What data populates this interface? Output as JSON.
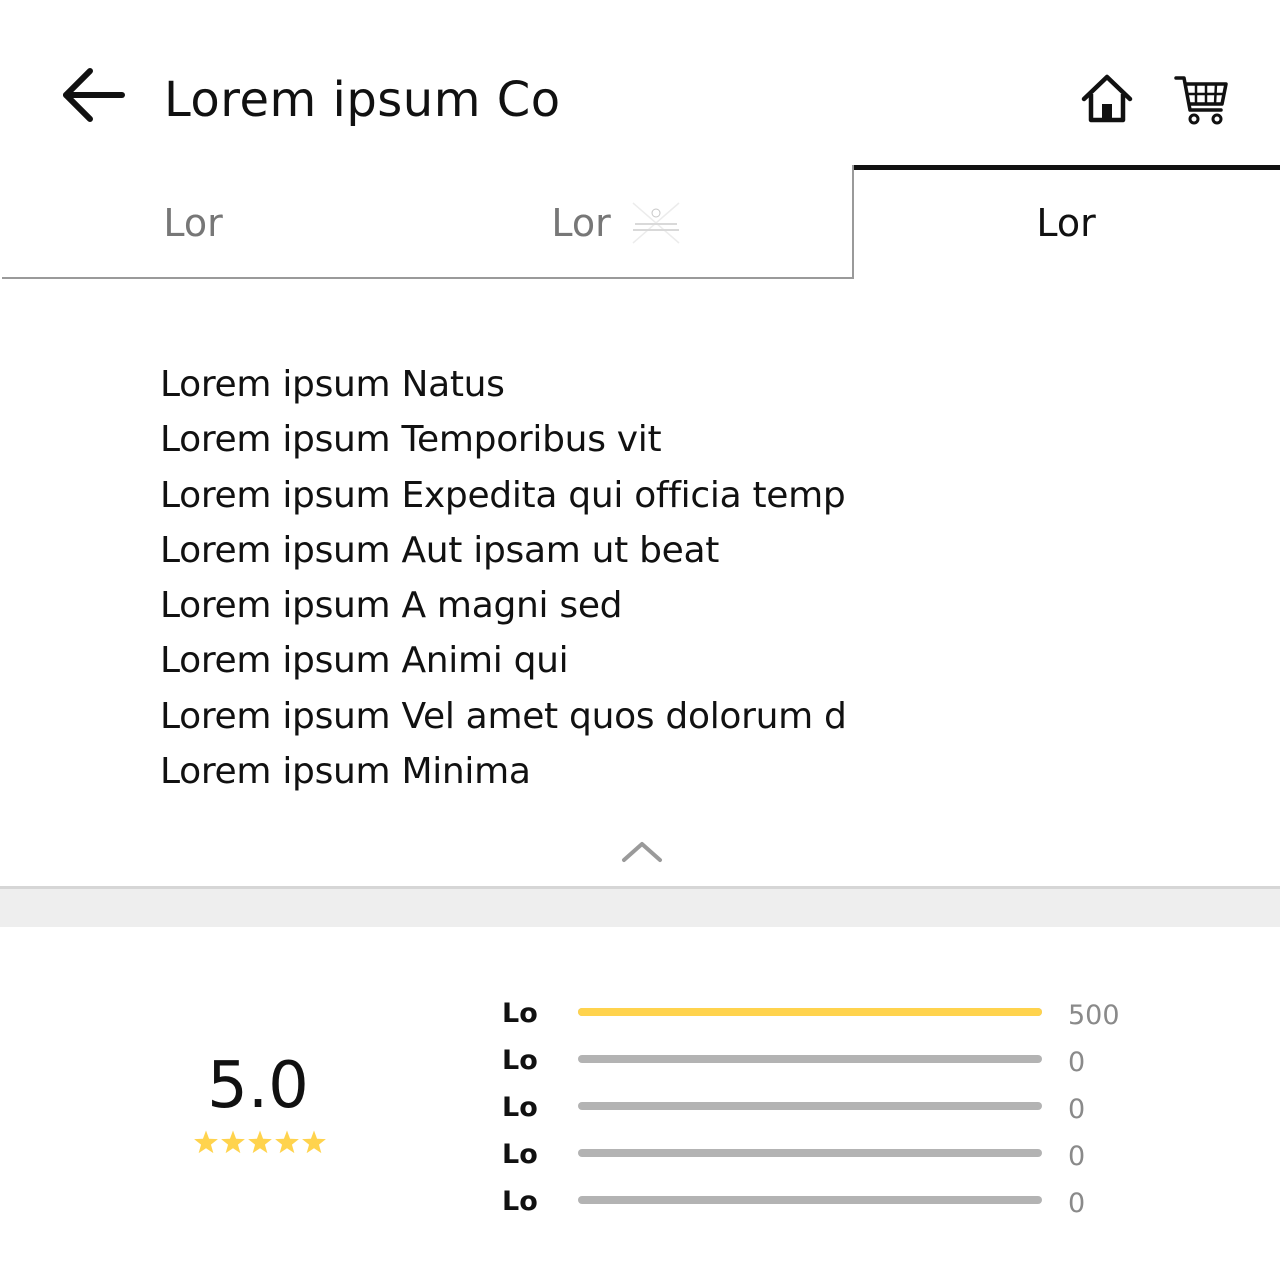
{
  "header": {
    "title": "Lorem ipsum Co",
    "back_icon": "arrow-left-icon",
    "home_icon": "home-icon",
    "cart_icon": "cart-icon"
  },
  "tabs": [
    {
      "label": "Lor",
      "active": false
    },
    {
      "label": "Lor",
      "active": false
    },
    {
      "label": "Lor",
      "active": true
    }
  ],
  "description": {
    "lines": [
      "Lorem ipsum Natus",
      "Lorem ipsum Temporibus vit",
      "Lorem ipsum Expedita qui officia temp",
      "Lorem ipsum Aut ipsam ut beat",
      "Lorem ipsum A magni sed",
      "Lorem ipsum Animi qui",
      "Lorem ipsum Vel amet quos dolorum d",
      "Lorem ipsum Minima"
    ],
    "collapse_icon": "chevron-up-icon"
  },
  "rating": {
    "score": "5.0",
    "stars": 5,
    "rows": [
      {
        "label": "Lo",
        "count": "500",
        "fraction": 1.0
      },
      {
        "label": "Lo",
        "count": "0",
        "fraction": 0
      },
      {
        "label": "Lo",
        "count": "0",
        "fraction": 0
      },
      {
        "label": "Lo",
        "count": "0",
        "fraction": 0
      },
      {
        "label": "Lo",
        "count": "0",
        "fraction": 0
      }
    ]
  },
  "colors": {
    "accent_star": "#ffd34d",
    "track": "#b3b3b3",
    "text": "#111111",
    "muted": "#777777"
  }
}
